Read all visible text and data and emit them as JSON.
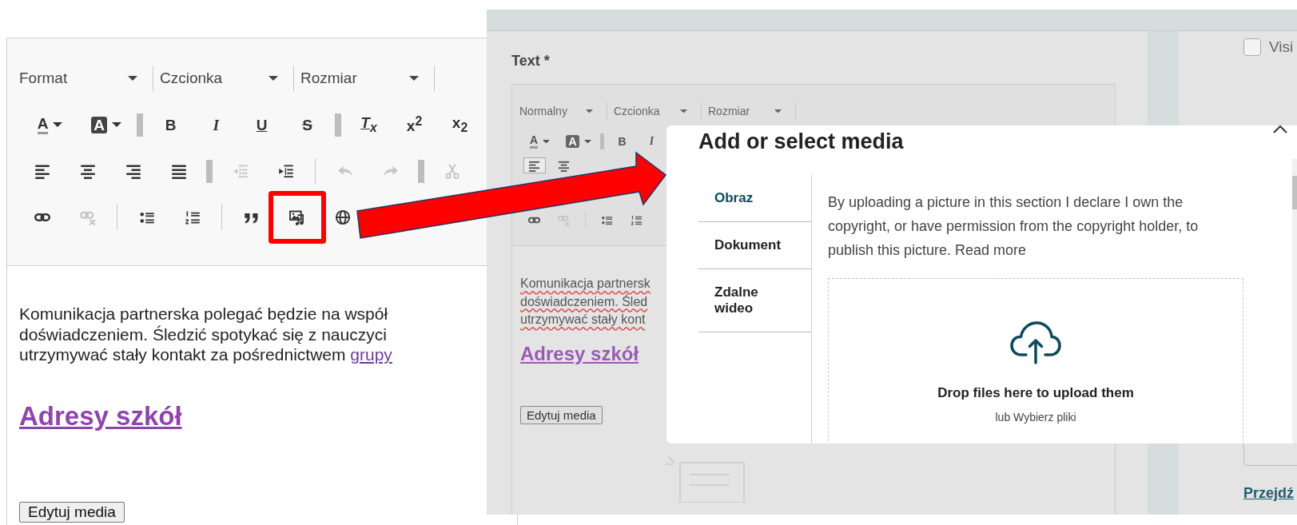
{
  "editor": {
    "toolbar": {
      "dropdowns": [
        {
          "label": "Format"
        },
        {
          "label": "Czcionka"
        },
        {
          "label": "Rozmiar"
        }
      ],
      "rows": [
        [
          {
            "kind": "bar",
            "items": [
              {
                "kind": "textcolor",
                "text": "A",
                "disabled": false,
                "active": false
              },
              {
                "kind": "bgcolor",
                "text": "A",
                "disabled": false,
                "active": false
              }
            ]
          },
          {
            "kind": "bar",
            "items": [
              {
                "kind": "bold",
                "text": "B",
                "disabled": false,
                "active": false
              },
              {
                "kind": "italic",
                "text": "I",
                "disabled": false,
                "active": false
              },
              {
                "kind": "underline",
                "text": "U",
                "disabled": false,
                "active": false
              },
              {
                "kind": "strike",
                "text": "S",
                "disabled": false,
                "active": false
              }
            ]
          },
          {
            "kind": "bar",
            "items": [
              {
                "kind": "removeformat",
                "text": "T$_{x}$",
                "disabled": false,
                "active": false
              },
              {
                "kind": "superscript",
                "text": "x$^{2}$",
                "disabled": false,
                "active": false
              },
              {
                "kind": "subscript",
                "text": "x$_{2}$",
                "disabled": false,
                "active": false
              }
            ]
          }
        ],
        [
          {
            "kind": "bar",
            "items": [
              {
                "kind": "alignleft",
                "disabled": false,
                "active": false
              },
              {
                "kind": "aligncenter",
                "disabled": false,
                "active": false
              },
              {
                "kind": "alignright",
                "disabled": false,
                "active": false
              },
              {
                "kind": "justify",
                "disabled": false,
                "active": false
              }
            ]
          },
          {
            "kind": "line",
            "items": [
              {
                "kind": "outdent",
                "disabled": true,
                "active": false
              },
              {
                "kind": "indent",
                "disabled": false,
                "active": false
              }
            ]
          },
          {
            "kind": "bar",
            "items": [
              {
                "kind": "undo",
                "disabled": true,
                "active": false
              },
              {
                "kind": "redo",
                "disabled": true,
                "active": false
              }
            ]
          },
          {
            "kind": "plain",
            "items": [
              {
                "kind": "cut",
                "disabled": true,
                "active": false
              }
            ]
          }
        ],
        [
          {
            "kind": "line",
            "items": [
              {
                "kind": "link",
                "disabled": false,
                "active": false
              },
              {
                "kind": "unlink",
                "disabled": true,
                "active": false
              }
            ]
          },
          {
            "kind": "line",
            "items": [
              {
                "kind": "bullets",
                "disabled": false,
                "active": false
              },
              {
                "kind": "numbers",
                "disabled": false,
                "active": false
              }
            ]
          },
          {
            "kind": "plain",
            "items": [
              {
                "kind": "quote",
                "disabled": false,
                "active": false
              },
              {
                "kind": "media",
                "disabled": false,
                "active": false
              },
              {
                "kind": "globe",
                "disabled": false,
                "active": false
              }
            ]
          }
        ]
      ]
    },
    "paragraph": {
      "lines": [
        "Komunikacja partnerska polegać będzie na współ",
        "doświadczeniem. Śledzić spotykać się z nauczyci",
        "utrzymywać stały kontakt za pośrednictwem "
      ],
      "link": "grupy"
    },
    "heading": "Adresy szkół",
    "button": "Edytuj media"
  },
  "background_page": {
    "field_label": "Text *",
    "editor": {
      "toolbar": {
        "dropdowns": [
          {
            "label": "Normalny"
          },
          {
            "label": "Czcionka"
          },
          {
            "label": "Rozmiar"
          }
        ],
        "rows": [
          [
            {
              "kind": "bar",
              "items": [
                {
                  "kind": "textcolor",
                  "text": "A",
                  "disabled": false,
                  "active": false
                },
                {
                  "kind": "bgcolor",
                  "text": "A",
                  "disabled": false,
                  "active": false
                }
              ]
            },
            {
              "kind": "plain",
              "items": [
                {
                  "kind": "bold",
                  "text": "B",
                  "disabled": false,
                  "active": false
                },
                {
                  "kind": "italic",
                  "text": "I",
                  "disabled": false,
                  "active": false
                }
              ]
            }
          ],
          [
            {
              "kind": "plain",
              "items": [
                {
                  "kind": "alignleft",
                  "disabled": false,
                  "active": true
                },
                {
                  "kind": "aligncenter",
                  "disabled": false,
                  "active": false
                }
              ]
            }
          ],
          [
            {
              "kind": "line",
              "items": [
                {
                  "kind": "link",
                  "disabled": false,
                  "active": false
                },
                {
                  "kind": "unlink",
                  "disabled": true,
                  "active": false
                }
              ]
            },
            {
              "kind": "plain",
              "items": [
                {
                  "kind": "bullets",
                  "disabled": false,
                  "active": false
                },
                {
                  "kind": "numbers",
                  "disabled": false,
                  "active": false
                }
              ]
            }
          ]
        ]
      },
      "lines": [
        "Komunikacja partnersk",
        "doświadczeniem. Śled",
        "utrzymywać stały kont"
      ],
      "heading": "Adresy szkół",
      "button": "Edytuj media"
    },
    "side": {
      "checkbox": {
        "label": "Visi",
        "checked": false
      },
      "link": "Przejdź"
    }
  },
  "modal": {
    "title": "Add or select media",
    "tabs": [
      {
        "label": "Obraz",
        "selected": true
      },
      {
        "label": "Dokument",
        "selected": false
      },
      {
        "label": "Zdalne wideo",
        "selected": false
      }
    ],
    "notice": "By uploading a picture in this section I declare I own the copyright, or have permission from the copyright holder, to publish this picture. Read more",
    "dropzone": {
      "title": "Drop files here to upload them",
      "subtitle": "lub Wybierz pliki"
    }
  }
}
